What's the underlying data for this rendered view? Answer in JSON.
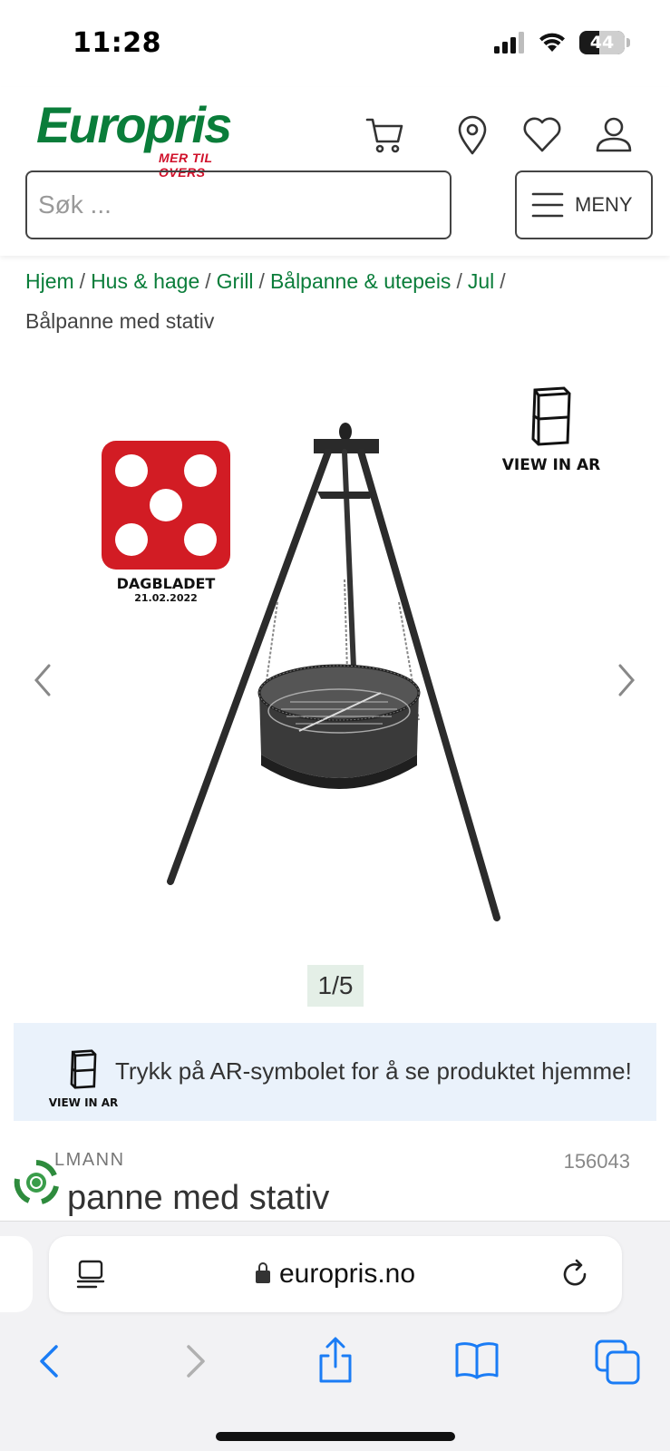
{
  "status_bar": {
    "time": "11:28",
    "battery": "44"
  },
  "header": {
    "logo_name": "Europris",
    "logo_tagline": "MER TIL OVERS",
    "search_placeholder": "Søk ...",
    "menu_label": "MENY",
    "icons": [
      "cart-icon",
      "location-pin-icon",
      "heart-icon",
      "user-icon"
    ]
  },
  "breadcrumb": {
    "items": [
      "Hjem",
      "Hus & hage",
      "Grill",
      "Bålpanne & utepeis",
      "Jul"
    ],
    "current": "Bålpanne med stativ"
  },
  "gallery": {
    "award_name": "DAGBLADET",
    "award_date": "21.02.2022",
    "view_in_ar": "VIEW IN AR",
    "counter": "1/5"
  },
  "ar_banner": {
    "icon_label": "VIEW IN AR",
    "message": "Trykk på AR-symbolet for å se produktet hjemme!"
  },
  "product": {
    "brand": "LMANN",
    "sku": "156043",
    "title": "panne med stativ"
  },
  "browser": {
    "url": "europris.no"
  },
  "colors": {
    "brand_green": "#0a7d3a",
    "brand_red": "#d0102a",
    "award_red": "#d21c24",
    "ios_blue": "#1a7cf5"
  }
}
